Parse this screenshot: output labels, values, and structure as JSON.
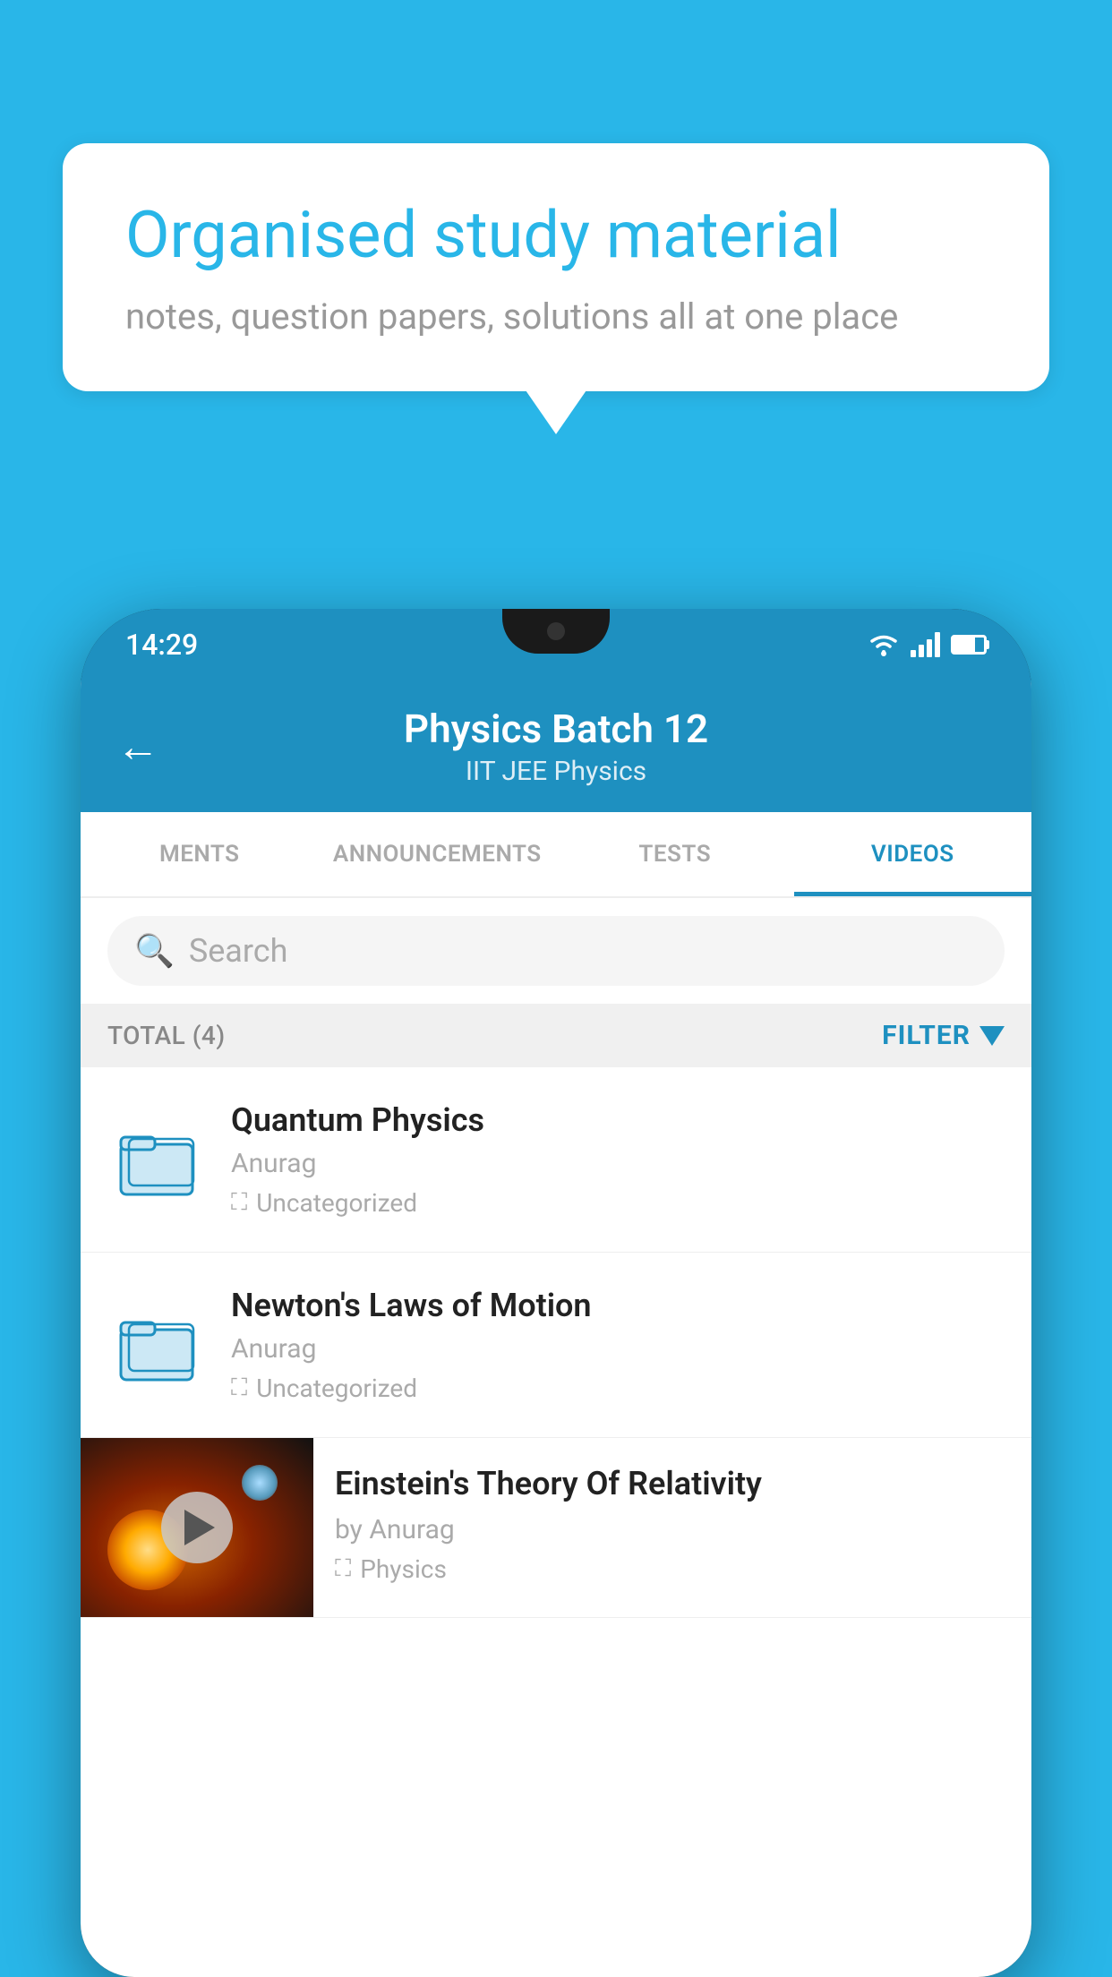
{
  "background_color": "#29b6e8",
  "speech_bubble": {
    "title": "Organised study material",
    "subtitle": "notes, question papers, solutions all at one place"
  },
  "phone": {
    "status_bar": {
      "time": "14:29",
      "wifi": "wifi-icon",
      "signal": "signal-icon",
      "battery": "battery-icon"
    },
    "header": {
      "back_label": "←",
      "title": "Physics Batch 12",
      "subtitle": "IIT JEE   Physics"
    },
    "tabs": [
      {
        "label": "MENTS",
        "active": false
      },
      {
        "label": "ANNOUNCEMENTS",
        "active": false
      },
      {
        "label": "TESTS",
        "active": false
      },
      {
        "label": "VIDEOS",
        "active": true
      }
    ],
    "search": {
      "placeholder": "Search"
    },
    "filter_bar": {
      "total_label": "TOTAL (4)",
      "filter_label": "FILTER"
    },
    "videos": [
      {
        "id": 1,
        "title": "Quantum Physics",
        "author": "Anurag",
        "tag": "Uncategorized",
        "has_thumbnail": false
      },
      {
        "id": 2,
        "title": "Newton's Laws of Motion",
        "author": "Anurag",
        "tag": "Uncategorized",
        "has_thumbnail": false
      },
      {
        "id": 3,
        "title": "Einstein's Theory Of Relativity",
        "author": "by Anurag",
        "tag": "Physics",
        "has_thumbnail": true
      }
    ]
  }
}
